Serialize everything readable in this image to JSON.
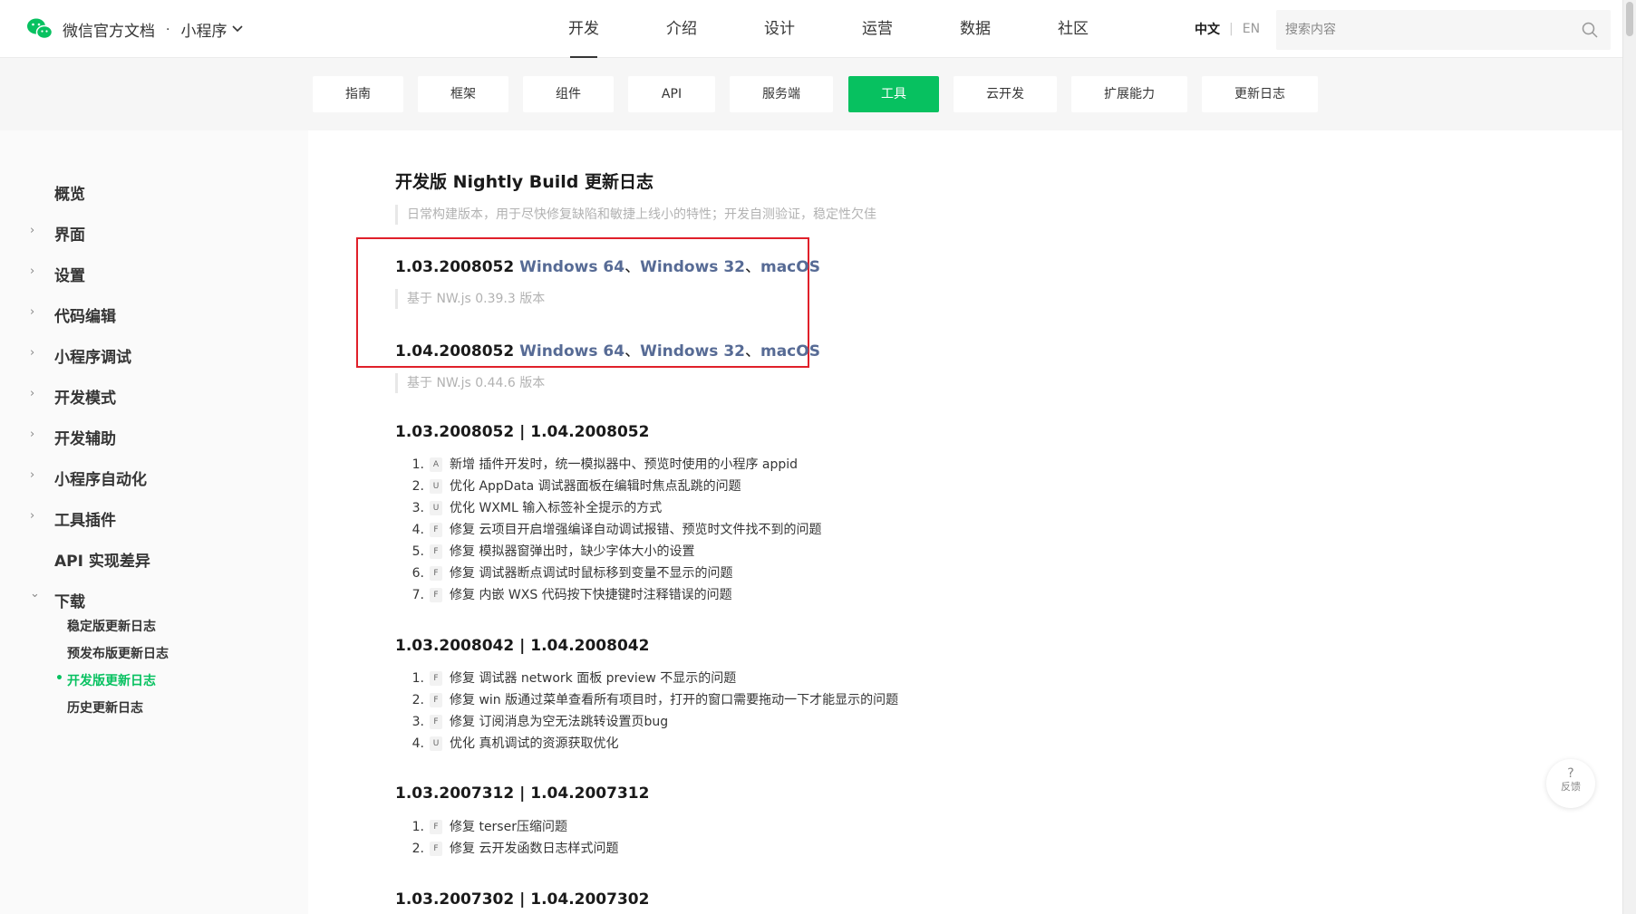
{
  "header": {
    "brand_title": "微信官方文档",
    "brand_dot": "·",
    "brand_section": "小程序",
    "nav": [
      "开发",
      "介绍",
      "设计",
      "运营",
      "数据",
      "社区"
    ],
    "active_nav": "开发",
    "lang_zh": "中文",
    "lang_sep": "|",
    "lang_en": "EN",
    "search_placeholder": "搜索内容"
  },
  "subnav": {
    "tabs": [
      "指南",
      "框架",
      "组件",
      "API",
      "服务端",
      "工具",
      "云开发",
      "扩展能力",
      "更新日志"
    ],
    "active": "工具"
  },
  "sidebar": {
    "items": [
      {
        "label": "概览",
        "arrow": ""
      },
      {
        "label": "界面",
        "arrow": "›"
      },
      {
        "label": "设置",
        "arrow": "›"
      },
      {
        "label": "代码编辑",
        "arrow": "›"
      },
      {
        "label": "小程序调试",
        "arrow": "›"
      },
      {
        "label": "开发模式",
        "arrow": "›"
      },
      {
        "label": "开发辅助",
        "arrow": "›"
      },
      {
        "label": "小程序自动化",
        "arrow": "›"
      },
      {
        "label": "工具插件",
        "arrow": "›"
      },
      {
        "label": "API 实现差异",
        "arrow": ""
      },
      {
        "label": "下载",
        "arrow": "⌄"
      }
    ],
    "sub_items": [
      "稳定版更新日志",
      "预发布版更新日志",
      "开发版更新日志",
      "历史更新日志"
    ],
    "active_sub": "开发版更新日志",
    "bullet": "•"
  },
  "content": {
    "title": "开发版 Nightly Build 更新日志",
    "intro": "日常构建版本，用于尽快修复缺陷和敏捷上线小的特性；开发自测验证，稳定性欠佳",
    "downloads": [
      {
        "version": "1.03.2008052",
        "win64": "Windows 64",
        "win32": "Windows 32",
        "mac": "macOS",
        "sep": "、",
        "note": "基于 NW.js 0.39.3 版本"
      },
      {
        "version": "1.04.2008052",
        "win64": "Windows 64",
        "win32": "Windows 32",
        "mac": "macOS",
        "sep": "、",
        "note": "基于 NW.js 0.44.6 版本"
      }
    ],
    "releases": [
      {
        "heading": "1.03.2008052 | 1.04.2008052",
        "items": [
          {
            "num": "1.",
            "tag": "A",
            "text": "新增 插件开发时，统一模拟器中、预览时使用的小程序 appid"
          },
          {
            "num": "2.",
            "tag": "U",
            "text": "优化 AppData 调试器面板在编辑时焦点乱跳的问题"
          },
          {
            "num": "3.",
            "tag": "U",
            "text": "优化 WXML 输入标签补全提示的方式"
          },
          {
            "num": "4.",
            "tag": "F",
            "text": "修复 云项目开启增强编译自动调试报错、预览时文件找不到的问题"
          },
          {
            "num": "5.",
            "tag": "F",
            "text": "修复 模拟器窗弹出时，缺少字体大小的设置"
          },
          {
            "num": "6.",
            "tag": "F",
            "text": "修复 调试器断点调试时鼠标移到变量不显示的问题"
          },
          {
            "num": "7.",
            "tag": "F",
            "text": "修复 内嵌 WXS 代码按下快捷键时注释错误的问题"
          }
        ]
      },
      {
        "heading": "1.03.2008042 | 1.04.2008042",
        "items": [
          {
            "num": "1.",
            "tag": "F",
            "text": "修复 调试器 network 面板 preview 不显示的问题"
          },
          {
            "num": "2.",
            "tag": "F",
            "text": "修复 win 版通过菜单查看所有项目时，打开的窗口需要拖动一下才能显示的问题"
          },
          {
            "num": "3.",
            "tag": "F",
            "text": "修复 订阅消息为空无法跳转设置页bug"
          },
          {
            "num": "4.",
            "tag": "U",
            "text": "优化 真机调试的资源获取优化"
          }
        ]
      },
      {
        "heading": "1.03.2007312 | 1.04.2007312",
        "items": [
          {
            "num": "1.",
            "tag": "F",
            "text": "修复 terser压缩问题"
          },
          {
            "num": "2.",
            "tag": "F",
            "text": "修复 云开发函数日志样式问题"
          }
        ]
      },
      {
        "heading": "1.03.2007302 | 1.04.2007302",
        "items": []
      }
    ]
  },
  "feedback": {
    "icon": "?",
    "label": "反馈"
  },
  "colors": {
    "brand_green": "#07c160",
    "link": "#576b95",
    "highlight_red": "#e0202a"
  }
}
